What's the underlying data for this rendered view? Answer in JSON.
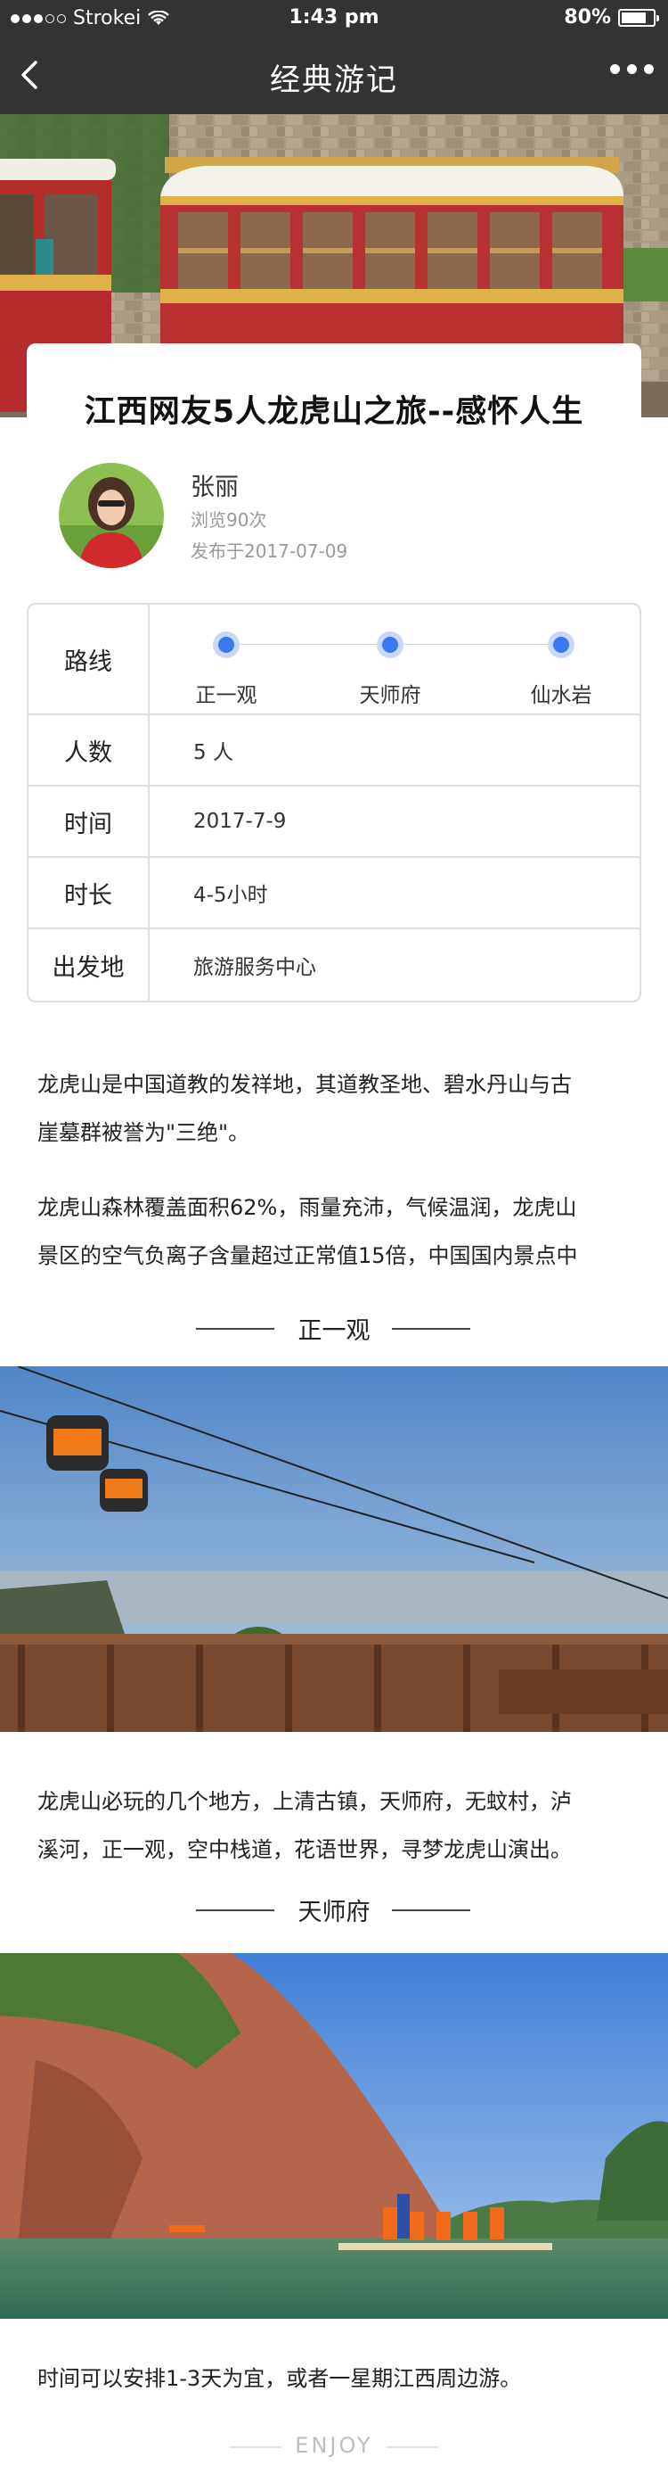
{
  "status_bar": {
    "carrier": "Strokei",
    "time": "1:43 pm",
    "battery_text": "80%",
    "battery_level": 0.8
  },
  "nav": {
    "title": "经典游记",
    "back_icon": "chevron-left-icon",
    "more_icon": "more-dots-icon"
  },
  "article": {
    "title": "江西网友5人龙虎山之旅--感怀人生"
  },
  "author": {
    "name": "张丽",
    "views": "浏览90次",
    "published": "发布于2017-07-09"
  },
  "info": {
    "route_label": "路线",
    "route_stops": [
      "正一观",
      "天师府",
      "仙水岩"
    ],
    "people_label": "人数",
    "people_value": "5 人",
    "time_label": "时间",
    "time_value": "2017-7-9",
    "duration_label": "时长",
    "duration_value": "4-5小时",
    "departure_label": "出发地",
    "departure_value": "旅游服务中心"
  },
  "content": {
    "para1_line1": "龙虎山是中国道教的发祥地，其道教圣地、碧水丹山与古",
    "para1_line2": "崖墓群被誉为\"三绝\"。",
    "para2_line1": "龙虎山森林覆盖面积62%，雨量充沛，气候温润，龙虎山",
    "para2_line2": "景区的空气负离子含量超过正常值15倍，中国国内景点中",
    "section1": "正一观",
    "para3_line1": "龙虎山必玩的几个地方，上清古镇，天师府，无蚊村，泸",
    "para3_line2": "溪河，正一观，空中栈道，花语世界，寻梦龙虎山演出。",
    "section2": "天师府",
    "para4": "时间可以安排1-3天为宜，或者一星期江西周边游。",
    "footer": "ENJOY"
  },
  "colors": {
    "bar_bg": "#333333",
    "route_dot": "#3a78f0",
    "route_dot_halo": "#c9d8f7",
    "border": "#dcdcdc"
  }
}
